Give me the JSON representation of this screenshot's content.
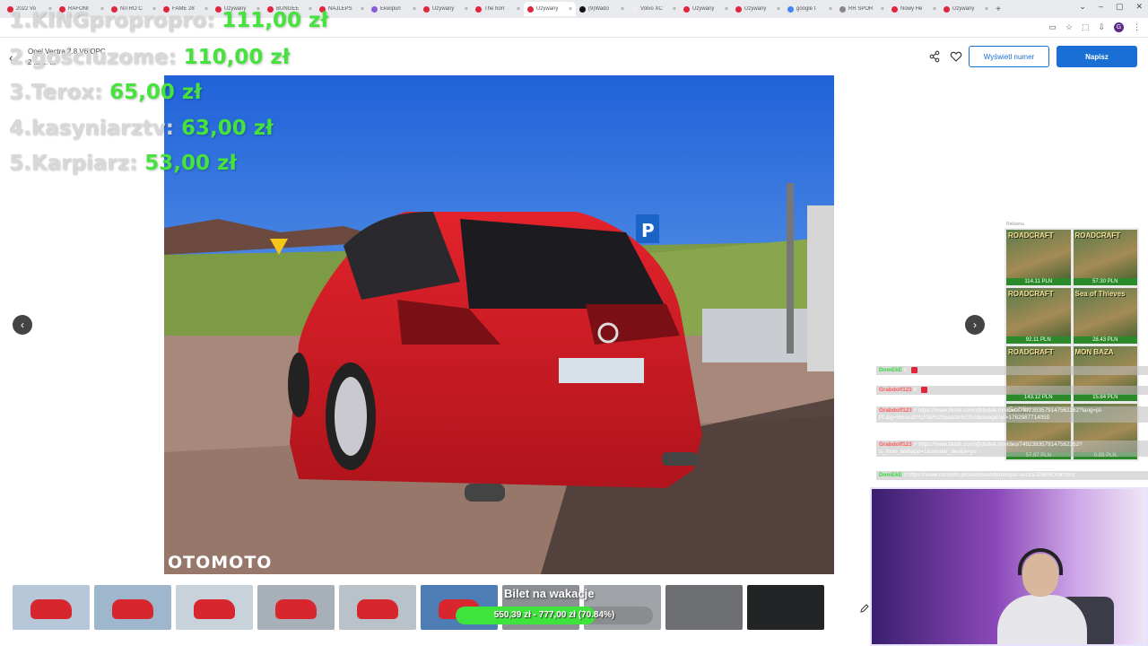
{
  "browser": {
    "tabs": [
      {
        "label": "2022 Vo",
        "color": "#e0263c"
      },
      {
        "label": "RAFONI",
        "color": "#e0263c"
      },
      {
        "label": "NITRO C",
        "color": "#e0263c"
      },
      {
        "label": "FAME 28",
        "color": "#e0263c"
      },
      {
        "label": "Używany",
        "color": "#e0263c"
      },
      {
        "label": "BUNGEE",
        "color": "#e0263c"
      },
      {
        "label": "NAJLEPS",
        "color": "#e0263c"
      },
      {
        "label": "Ekwipun",
        "color": "#8c5cd6"
      },
      {
        "label": "Używany",
        "color": "#e0263c"
      },
      {
        "label": "The horr",
        "color": "#e0263c"
      },
      {
        "label": "Używany",
        "color": "#e0263c",
        "active": true
      },
      {
        "label": "(9)Wado",
        "color": "#111111"
      },
      {
        "label": "Volvo XC",
        "color": "#eeeeee"
      },
      {
        "label": "Używany",
        "color": "#e0263c"
      },
      {
        "label": "Używany",
        "color": "#e0263c"
      },
      {
        "label": "google t",
        "color": "#4285f4"
      },
      {
        "label": "RR SPOR",
        "color": "#888888"
      },
      {
        "label": "Nowy He",
        "color": "#e0263c"
      },
      {
        "label": "Używany",
        "color": "#e0263c"
      }
    ],
    "new_tab": "+",
    "window_controls": [
      "⌄",
      "–",
      "▢",
      "✕"
    ],
    "profile_initial": "G"
  },
  "listing": {
    "title": "Opel Vectra 2.8 V6 OPC",
    "subtitle": "2 ... ... ...",
    "show_number_label": "Wyświetl numer",
    "write_label": "Napisz",
    "watermark": "OTOMOTO",
    "thumbnail_count": 10
  },
  "leaderboard": [
    {
      "rank_name": "1.KINGpropropro:",
      "amount": "111,00 zł"
    },
    {
      "rank_name": "2.gościuzome:",
      "amount": "110,00 zł"
    },
    {
      "rank_name": "3.Terox:",
      "amount": "65,00 zł"
    },
    {
      "rank_name": "4.kasyniarztv:",
      "amount": "63,00 zł"
    },
    {
      "rank_name": "5.Karpiarz:",
      "amount": "53,00 zł"
    }
  ],
  "ads": {
    "label": "Reklama",
    "items": [
      {
        "name": "ROADCRAFT",
        "price": "114.11 PLN"
      },
      {
        "name": "ROADCRAFT",
        "price": "57.30 PLN"
      },
      {
        "name": "ROADCRAFT",
        "price": "92.11 PLN"
      },
      {
        "name": "Sea of Thieves",
        "price": "28.43 PLN"
      },
      {
        "name": "ROADCRAFT",
        "price": "143.12 PLN"
      },
      {
        "name": "MON BAZA",
        "price": "15.84 PLN"
      },
      {
        "name": "Goblin",
        "price": "57.97 PLN"
      },
      {
        "name": "",
        "price": "0.85 PLN"
      }
    ]
  },
  "chat": [
    {
      "user": "DomEkE",
      "msg": "",
      "user_color": "green"
    },
    {
      "user": "Grabdolf123",
      "msg": "",
      "user_color": "red"
    },
    {
      "user": "Grabdolf123",
      "msg": "https://www.tiktok.com/@dvdek.m/video/7492393579147562262?lang=pl-PL&q=%merdz%20te%20wasze%20volkswagenyt=1762987714059",
      "user_color": "red"
    },
    {
      "user": "Grabdolf123",
      "msg": "https://www.tiktok.com/@dvdek.m/video/7492393579147562262?is_from_webapp=1&sender_device=pc",
      "user_color": "red"
    },
    {
      "user": "DomEkE",
      "msg": "https://www.otomoto.pl/osobowe/oferta/opel-vectra-ID6HKXW.html",
      "user_color": "green"
    }
  ],
  "goal": {
    "title": "Bilet na wakacje",
    "current": "550,39 zł",
    "target": "777,00 zł",
    "percent_label": "(70.84%)",
    "progress": 0.7084
  }
}
